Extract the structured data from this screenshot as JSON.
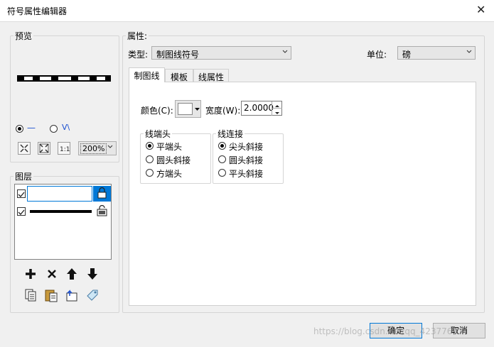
{
  "window": {
    "title": "符号属性编辑器"
  },
  "preview": {
    "legend": "预览",
    "mode_line_label": "—",
    "mode_wave_label": "ᐯ\\",
    "zoom_value": "200%"
  },
  "layers": {
    "legend": "图层"
  },
  "properties": {
    "legend": "属性:",
    "type_label": "类型:",
    "type_value": "制图线符号",
    "unit_label": "单位:",
    "unit_value": "磅"
  },
  "tabs": [
    {
      "label": "制图线"
    },
    {
      "label": "模板"
    },
    {
      "label": "线属性"
    }
  ],
  "cartoline": {
    "color_label": "颜色(C):",
    "width_label": "宽度(W):",
    "width_value": "2.0000",
    "cap_legend": "线端头",
    "cap_options": [
      "平端头",
      "圆头斜接",
      "方端头"
    ],
    "join_legend": "线连接",
    "join_options": [
      "尖头斜接",
      "圆头斜接",
      "平头斜接"
    ]
  },
  "buttons": {
    "ok": "确定",
    "cancel": "取消"
  },
  "watermark": "https://blog.csdn.net/qq_42377697",
  "colors": {
    "selection_accent": "#0078d7",
    "window_bg": "#f0f0f0"
  }
}
